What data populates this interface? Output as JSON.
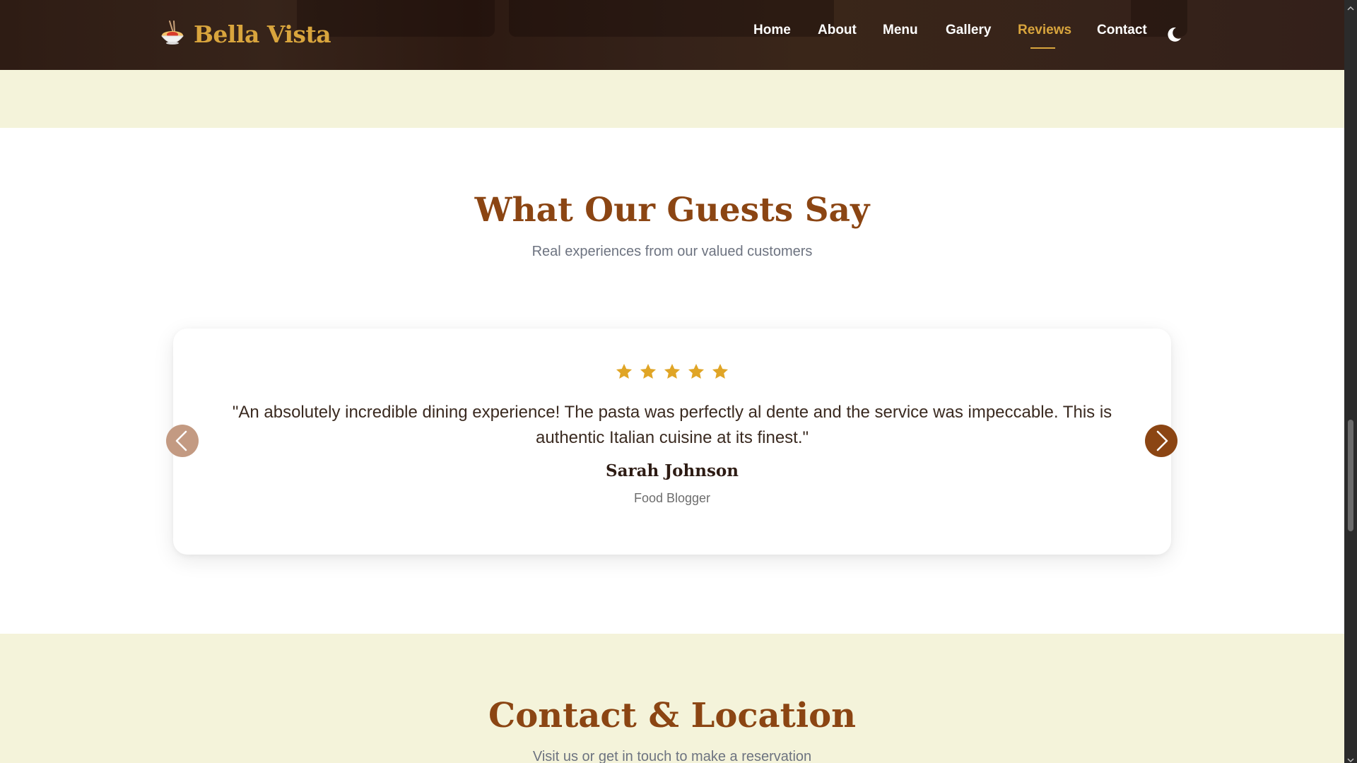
{
  "brand": {
    "name": "Bella Vista",
    "icon": "pasta-bowl-icon",
    "color": "#d9a53d"
  },
  "nav": {
    "items": [
      {
        "label": "Home",
        "active": false
      },
      {
        "label": "About",
        "active": false
      },
      {
        "label": "Menu",
        "active": false
      },
      {
        "label": "Gallery",
        "active": false
      },
      {
        "label": "Reviews",
        "active": true
      },
      {
        "label": "Contact",
        "active": false
      }
    ],
    "theme_toggle_icon": "moon-icon"
  },
  "reviews": {
    "title": "What Our Guests Say",
    "subtitle": "Real experiences from our valued customers",
    "current": {
      "rating": 5,
      "max_rating": 5,
      "quote": "\"An absolutely incredible dining experience! The pasta was perfectly al dente and the service was impeccable. This is authentic Italian cuisine at its finest.\"",
      "author": "Sarah Johnson",
      "role": "Food Blogger"
    },
    "prev_icon": "chevron-left-icon",
    "next_icon": "chevron-right-icon"
  },
  "contact": {
    "title": "Contact & Location",
    "subtitle": "Visit us or get in touch to make a reservation"
  },
  "colors": {
    "accent": "#8b4513",
    "gold": "#d9a53d",
    "nav_bg": "#33201a",
    "band_bg": "#f4f3da",
    "star": "#e0a526"
  }
}
